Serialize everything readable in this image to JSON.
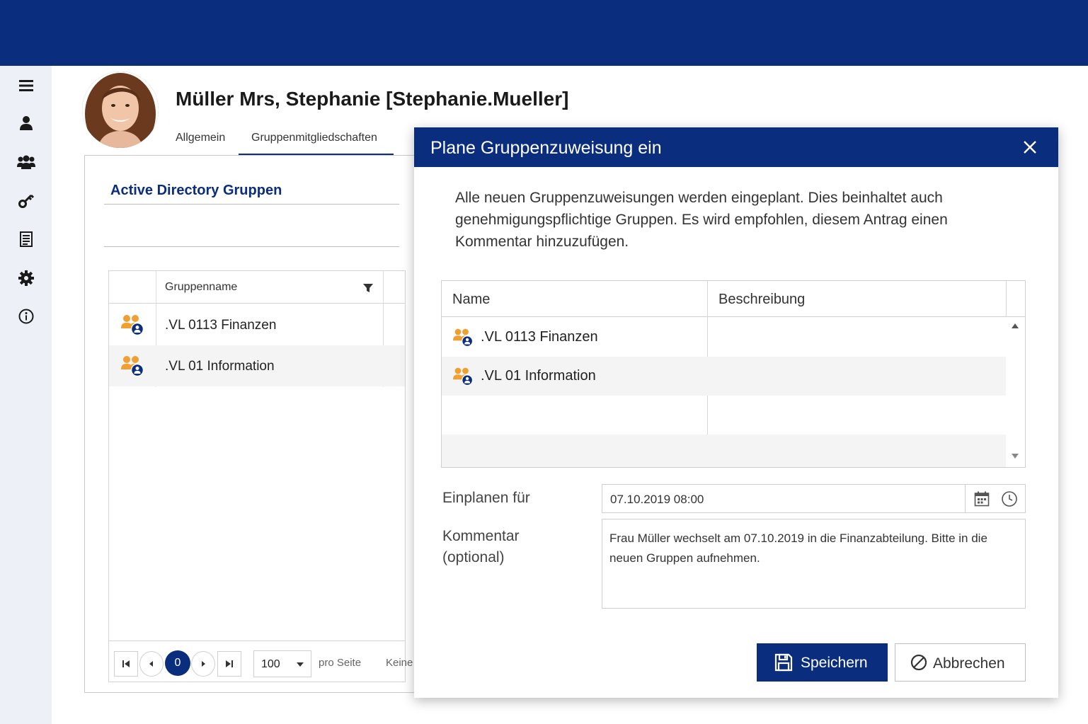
{
  "colors": {
    "primary": "#0a2d7e",
    "group_icon_orange": "#f0a030",
    "sidebar_bg": "#eef0f8",
    "row_stripe": "#f4f4f4"
  },
  "sidebar": {
    "items": [
      {
        "icon": "menu-icon"
      },
      {
        "icon": "user-icon"
      },
      {
        "icon": "users-group-icon"
      },
      {
        "icon": "key-icon"
      },
      {
        "icon": "document-list-icon"
      },
      {
        "icon": "gear-icon"
      },
      {
        "icon": "info-icon"
      }
    ]
  },
  "profile": {
    "avatar": "user-photo",
    "name": "Müller Mrs, Stephanie [Stephanie.Mueller]",
    "tabs": [
      {
        "label": "Allgemein",
        "active": false
      },
      {
        "label": "Gruppenmitgliedschaften",
        "active": true
      }
    ]
  },
  "groups_panel": {
    "title": "Active Directory Gruppen",
    "column_header": "Gruppenname",
    "rows": [
      {
        "name": ".VL 0113 Finanzen",
        "icon": "group-icon"
      },
      {
        "name": ".VL 01 Information",
        "icon": "group-icon"
      }
    ],
    "pager": {
      "current_page": "0",
      "page_size": "100",
      "per_page_label": "pro Seite",
      "status_text": "Keine"
    }
  },
  "dialog": {
    "title": "Plane Gruppenzuweisung ein",
    "description": "Alle neuen Gruppenzuweisungen werden eingeplant. Dies beinhaltet auch genehmigungspflichtige Gruppen. Es wird empfohlen, diesem Antrag einen Kommentar hinzuzufügen.",
    "table": {
      "columns": [
        "Name",
        "Beschreibung"
      ],
      "rows": [
        {
          "name": ".VL 0113 Finanzen",
          "description": ""
        },
        {
          "name": ".VL 01 Information",
          "description": ""
        }
      ]
    },
    "schedule_label": "Einplanen für",
    "schedule_value": "07.10.2019 08:00",
    "comment_label_line1": "Kommentar",
    "comment_label_line2": "(optional)",
    "comment_value": "Frau Müller wechselt am 07.10.2019 in die Finanzabteilung. Bitte in die neuen Gruppen aufnehmen.",
    "save_label": "Speichern",
    "cancel_label": "Abbrechen"
  }
}
